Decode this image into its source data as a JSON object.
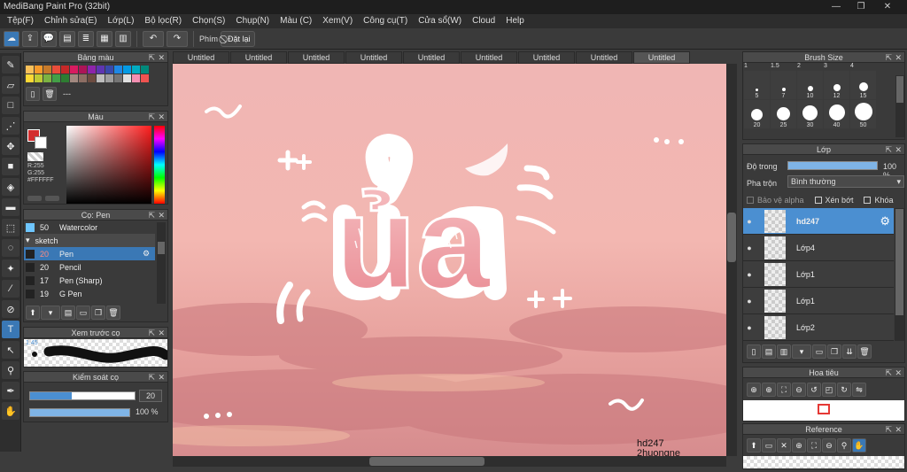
{
  "window": {
    "title": "MediBang Paint Pro (32bit)"
  },
  "menu": [
    "Tệp(F)",
    "Chỉnh sửa(E)",
    "Lớp(L)",
    "Bộ lọc(R)",
    "Chọn(S)",
    "Chụp(N)",
    "Màu (C)",
    "Xem(V)",
    "Công cụ(T)",
    "Cửa sổ(W)",
    "Cloud",
    "Help"
  ],
  "toolbar": {
    "keys_label": "Phím",
    "cancel_label": "Đặt lại"
  },
  "tabs": [
    "Untitled",
    "Untitled",
    "Untitled",
    "Untitled",
    "Untitled",
    "Untitled",
    "Untitled",
    "Untitled",
    "Untitled"
  ],
  "palette": {
    "title": "Bảng màu",
    "colors": [
      "#f7c05a",
      "#f79a2a",
      "#c77a2a",
      "#e94d3a",
      "#c62828",
      "#d81b60",
      "#ad1457",
      "#8e24aa",
      "#5e35b1",
      "#3949ab",
      "#1e88e5",
      "#039be5",
      "#00acc1",
      "#00897b",
      "#fdd835",
      "#c0ca33",
      "#7cb342",
      "#43a047",
      "#2e7d32",
      "#a1887f",
      "#8d6e63",
      "#6d4c41",
      "#bdbdbd",
      "#9e9e9e",
      "#757575",
      "#e0e0e0",
      "#f48fb1",
      "#ef5350"
    ],
    "name": "---"
  },
  "color": {
    "title": "Màu",
    "r": "R:255",
    "g": "G:255",
    "hex": "#FFFFFF"
  },
  "brush": {
    "title": "Cọ: Pen",
    "items": [
      {
        "size": "50",
        "name": "Watercolor",
        "sel": false
      },
      {
        "size": "20",
        "name": "Pen",
        "sel": true
      },
      {
        "size": "20",
        "name": "Pencil",
        "sel": false
      },
      {
        "size": "17",
        "name": "Pen (Sharp)",
        "sel": false
      },
      {
        "size": "19",
        "name": "G Pen",
        "sel": false
      }
    ],
    "group": "sketch"
  },
  "preview": {
    "title": "Xem trước cọ",
    "size": "1.45"
  },
  "brushctl": {
    "title": "Kiểm soát cọ",
    "size": "20",
    "size_fraction": 0.4,
    "opacity": "100 %",
    "opacity_fraction": 1.0
  },
  "brushsize": {
    "title": "Brush Size",
    "top": [
      "1",
      "1.5",
      "2",
      "3",
      "4"
    ],
    "row1": [
      "5",
      "7",
      "10",
      "12",
      "15"
    ],
    "row2": [
      "20",
      "25",
      "30",
      "40",
      "50"
    ]
  },
  "layers": {
    "title": "Lớp",
    "opacity_label": "Độ trong",
    "opacity": "100 %",
    "blend_label": "Pha trộn",
    "blend": "Bình thường",
    "protect_alpha": "Bảo vệ alpha",
    "clipping": "Xén bớt",
    "lock": "Khóa",
    "items": [
      {
        "name": "hd247",
        "sel": true
      },
      {
        "name": "Lớp4",
        "sel": false
      },
      {
        "name": "Lớp1",
        "sel": false
      },
      {
        "name": "Lớp1",
        "sel": false
      },
      {
        "name": "Lớp2",
        "sel": false
      }
    ]
  },
  "navigator": {
    "title": "Hoa tiêu"
  },
  "reference": {
    "title": "Reference"
  },
  "artwork": {
    "main_text": "ủa",
    "watermark1": "hd247",
    "watermark2": "2huongne"
  },
  "colors": {
    "accent": "#3a78b5",
    "layer_sel": "#4b8fd1"
  }
}
